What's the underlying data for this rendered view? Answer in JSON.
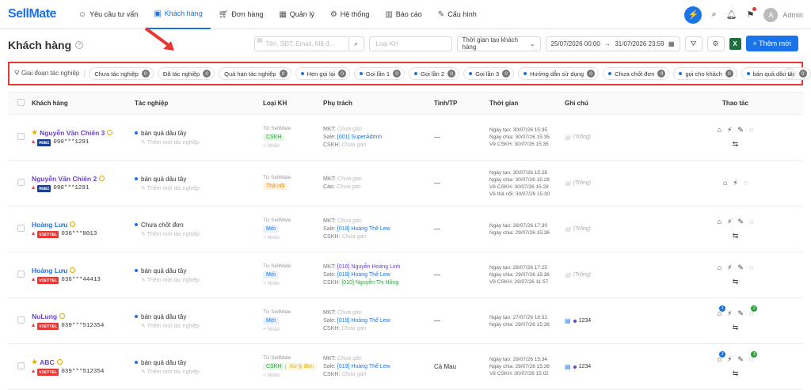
{
  "brand": {
    "logo_a": "Sell",
    "logo_b": "Mate"
  },
  "nav": [
    {
      "label": "Yêu cầu tư vấn",
      "icon": "chat-icon"
    },
    {
      "label": "Khách hàng",
      "icon": "contact-card-icon"
    },
    {
      "label": "Đơn hàng",
      "icon": "cart-icon"
    },
    {
      "label": "Quản lý",
      "icon": "grid-icon"
    },
    {
      "label": "Hệ thống",
      "icon": "gear-icon"
    },
    {
      "label": "Báo cáo",
      "icon": "chart-icon"
    },
    {
      "label": "Cấu hình",
      "icon": "wrench-icon"
    }
  ],
  "user": {
    "initial": "A",
    "name": "Admin"
  },
  "page": {
    "title": "Khách hàng"
  },
  "filters": {
    "search_placeholder": "Tên, SĐT, Email, Mã đ...",
    "type_placeholder": "Loại KH",
    "time_select": "Thời gian tạo khách hàng",
    "date_from": "25/07/2026 00:00",
    "date_to": "31/07/2026 23:59",
    "new_button": "+ Thêm mới",
    "excel_label": "X"
  },
  "stages": {
    "title": "Giai đoạn tác nghiệp",
    "chips": [
      {
        "label": "Chưa tác nghiệp",
        "count": "0",
        "dot": false
      },
      {
        "label": "Đã tác nghiệp",
        "count": "0",
        "dot": false
      },
      {
        "label": "Quá hạn tác nghiệp",
        "count": "0",
        "dot": false
      },
      {
        "label": "Hẹn gọi lại",
        "count": "0",
        "dot": true
      },
      {
        "label": "Gọi lần 1",
        "count": "0",
        "dot": true
      },
      {
        "label": "Gọi lần 2",
        "count": "0",
        "dot": true
      },
      {
        "label": "Gọi lần 3",
        "count": "0",
        "dot": true
      },
      {
        "label": "Hướng dẫn sử dụng",
        "count": "0",
        "dot": true
      },
      {
        "label": "Chưa chốt đơn",
        "count": "0",
        "dot": true
      },
      {
        "label": "gọi cho khách",
        "count": "0",
        "dot": true
      },
      {
        "label": "bán quả dâu tây",
        "count": "0",
        "dot": true
      }
    ]
  },
  "table": {
    "headers": [
      "Khách hàng",
      "Tác nghiệp",
      "Loại KH",
      "Phụ trách",
      "Tỉnh/TP",
      "Thời gian",
      "Ghi chú",
      "Thao tác"
    ],
    "rows": [
      {
        "name": "Nguyễn Văn Chiến 3",
        "star": true,
        "blue": false,
        "carrier": "MOBI",
        "phone": "090***1291",
        "task": "bán quả dâu tây",
        "add_task": "Thêm mới tác nghiệp",
        "source": "Từ SellMate",
        "tags": [
          {
            "t": "CSKH",
            "c": "cskh"
          }
        ],
        "add_label": "+ Nhãn",
        "owners": [
          {
            "k": "MKT:",
            "v": "Chưa gán",
            "c": "n"
          },
          {
            "k": "Sale:",
            "v": "[001] SuperAdmin",
            "c": "v"
          },
          {
            "k": "CSKH:",
            "v": "Chưa gán",
            "c": "n"
          }
        ],
        "province": "—",
        "times": [
          "Ngày tạo: 30/07/26 15:35",
          "Ngày chia: 30/07/26 15:35",
          "Về CSKH: 30/07/26 15:35"
        ],
        "note": "(Trống)",
        "note_real": false,
        "actions": [
          "cart-icon",
          "flash-icon",
          "edit-icon",
          "comment-icon",
          "swap-icon"
        ]
      },
      {
        "name": "Nguyễn Văn Chiến 2",
        "star": false,
        "blue": false,
        "carrier": "MOBI",
        "phone": "090***1291",
        "task": "bán quả dâu tây",
        "add_task": "Thêm mới tác nghiệp",
        "source": "Từ SellMate",
        "tags": [
          {
            "t": "Thả nổi",
            "c": "thanoi"
          }
        ],
        "add_label": "",
        "owners": [
          {
            "k": "MKT:",
            "v": "Chưa gán",
            "c": "n"
          },
          {
            "k": "Cáo:",
            "v": "Chưa gán",
            "c": "n"
          }
        ],
        "province": "—",
        "times": [
          "Ngày tạo: 30/07/26 15:28",
          "Ngày chia: 30/07/26 15:28",
          "Về CSKH: 30/07/26 15:28",
          "Về thả nổi: 30/07/26 15:30"
        ],
        "note": "(Trống)",
        "note_real": false,
        "actions": [
          "cart-icon",
          "flash-icon",
          "comment-icon"
        ]
      },
      {
        "name": "Hoàng Lưu",
        "star": false,
        "blue": true,
        "carrier": "VIETTEL",
        "phone": "036***8013",
        "task": "Chưa chốt đơn",
        "add_task": "Thêm mới tác nghiệp",
        "source": "Từ SellMate",
        "tags": [
          {
            "t": "Mới",
            "c": "moi"
          }
        ],
        "add_label": "+ Nhãn",
        "owners": [
          {
            "k": "MKT:",
            "v": "Chưa gán",
            "c": "n"
          },
          {
            "k": "Sale:",
            "v": "[019] Hoàng Thế Lew",
            "c": "v"
          },
          {
            "k": "CSKH:",
            "v": "Chưa gán",
            "c": "n"
          }
        ],
        "province": "—",
        "times": [
          "Ngày tạo: 28/07/26 17:30",
          "Ngày chia: 29/07/26 15:36"
        ],
        "note": "(Trống)",
        "note_real": false,
        "actions": [
          "cart-icon",
          "flash-icon",
          "edit-icon",
          "comment-icon",
          "swap-icon"
        ]
      },
      {
        "name": "Hoàng Lưu",
        "star": false,
        "blue": true,
        "carrier": "VIETTEL",
        "phone": "036***44413",
        "task": "bán quả dâu tây",
        "add_task": "Thêm mới tác nghiệp",
        "source": "Từ SellMate",
        "tags": [
          {
            "t": "Mới",
            "c": "moi"
          }
        ],
        "add_label": "+ Nhãn",
        "owners": [
          {
            "k": "MKT:",
            "v": "[016] Nguyễn Hoàng Linh",
            "c": "p"
          },
          {
            "k": "Sale:",
            "v": "[019] Hoàng Thế Lew",
            "c": "v"
          },
          {
            "k": "CSKH:",
            "v": "[010] Nguyễn Thị Hồng",
            "c": "g"
          }
        ],
        "province": "—",
        "times": [
          "Ngày tạo: 28/07/26 17:25",
          "Ngày chia: 29/07/26 15:36",
          "Về CSKH: 29/07/26 11:57"
        ],
        "note": "(Trống)",
        "note_real": false,
        "actions": [
          "cart-icon",
          "flash-icon",
          "edit-icon",
          "comment-icon",
          "swap-icon"
        ]
      },
      {
        "name": "NuLung",
        "star": false,
        "blue": false,
        "carrier": "VIETTEL",
        "phone": "039***512354",
        "task": "bán quả dâu tây",
        "add_task": "Thêm mới tác nghiệp",
        "source": "Từ SellMate",
        "tags": [
          {
            "t": "Mới",
            "c": "moi"
          }
        ],
        "add_label": "+ Nhãn",
        "owners": [
          {
            "k": "MKT:",
            "v": "Chưa gán",
            "c": "n"
          },
          {
            "k": "Sale:",
            "v": "[019] Hoàng Thế Lew",
            "c": "v"
          },
          {
            "k": "CSKH:",
            "v": "Chưa gán",
            "c": "n"
          }
        ],
        "province": "—",
        "times": [
          "Ngày tạo: 27/07/26 16:32",
          "Ngày chia: 29/07/26 15:36"
        ],
        "note": "1234",
        "note_real": true,
        "badge1": "1",
        "badge2": "2",
        "actions": [
          "cart-icon",
          "flash-icon",
          "edit-icon",
          "comment-icon",
          "swap-icon"
        ]
      },
      {
        "name": "ABC",
        "star": true,
        "blue": false,
        "carrier": "VIETTEL",
        "phone": "039***512354",
        "task": "bán quả dâu tây",
        "add_task": "Thêm mới tác nghiệp",
        "source": "Từ SellMate",
        "tags": [
          {
            "t": "CSKH",
            "c": "cskh"
          },
          {
            "t": "Xử lý đơn",
            "c": "xuly"
          }
        ],
        "add_label": "+ Nhãn",
        "owners": [
          {
            "k": "MKT:",
            "v": "Chưa gán",
            "c": "n"
          },
          {
            "k": "Sale:",
            "v": "[019] Hoàng Thế Lew",
            "c": "v"
          },
          {
            "k": "CSKH:",
            "v": "Chưa gán",
            "c": "n"
          }
        ],
        "province": "Cà Mau",
        "times": [
          "Ngày tạo: 29/07/26 15:34",
          "Ngày chia: 29/07/26 15:36",
          "Về CSKH: 30/07/26 15:02"
        ],
        "note": "1234",
        "note_real": true,
        "badge1": "1",
        "badge2": "3",
        "actions": [
          "cart-icon",
          "flash-icon",
          "edit-icon",
          "comment-icon",
          "swap-icon"
        ]
      }
    ]
  }
}
